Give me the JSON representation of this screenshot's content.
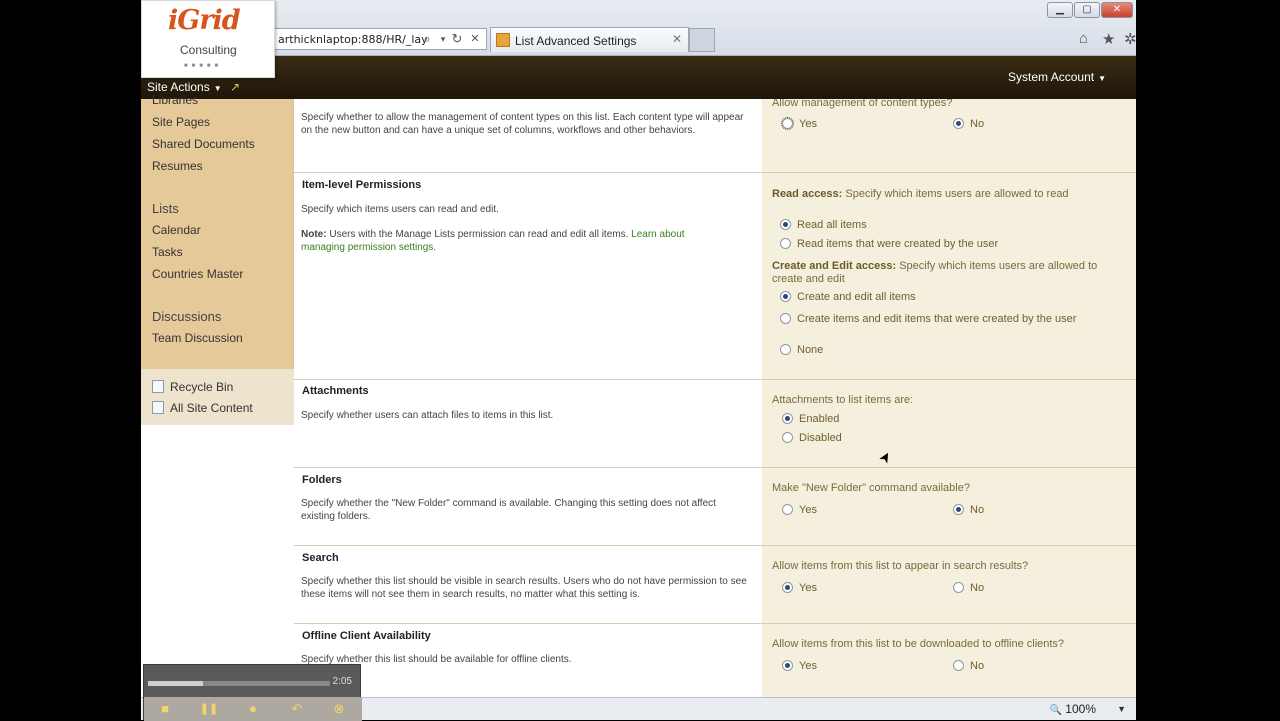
{
  "browser": {
    "address": "arthicknlaptop:888/HR/_lay",
    "tab_title": "List Advanced Settings",
    "search_glyph": "⌕",
    "dropdown_glyph": "▾",
    "refresh_glyph": "↻",
    "stop_glyph": "✕",
    "tab_close_glyph": "✕",
    "min_glyph": "▁",
    "max_glyph": "▢",
    "close_glyph": "✕",
    "home_glyph": "⌂",
    "fav_glyph": "★",
    "tools_glyph": "✲"
  },
  "logo": {
    "brand": "iGrid",
    "tagline": "Consulting",
    "dots": "■■■■■"
  },
  "ribbon": {
    "site_actions": "Site Actions",
    "site_actions_arrow": "▼",
    "nav_icon_glyph": "↗",
    "account": "System Account",
    "account_arrow": "▼"
  },
  "quicklaunch": {
    "libraries_cut": "Libraries",
    "items_libraries": [
      "Site Pages",
      "Shared Documents",
      "Resumes"
    ],
    "lists_heading": "Lists",
    "items_lists": [
      "Calendar",
      "Tasks",
      "Countries Master"
    ],
    "discussions_heading": "Discussions",
    "items_discussions": [
      "Team Discussion"
    ],
    "recycle_bin": "Recycle Bin",
    "all_site_content": "All Site Content"
  },
  "sections": {
    "content_types": {
      "desc": "Specify whether to allow the management of content types on this list. Each content type will appear on the new button and can have a unique set of columns, workflows and other behaviors.",
      "question": "Allow management of content types?",
      "yes": "Yes",
      "no": "No",
      "selected": "no"
    },
    "permissions": {
      "title": "Item-level Permissions",
      "desc": "Specify which items users can read and edit.",
      "note_label": "Note:",
      "note_text": "Users with the Manage Lists permission can read and edit all items.",
      "note_link": "Learn about managing permission settings.",
      "read_label": "Read access:",
      "read_text": "Specify which items users are allowed to read",
      "read_all": "Read all items",
      "read_own": "Read items that were created by the user",
      "edit_label": "Create and Edit access:",
      "edit_text": "Specify which items users are allowed to create and edit",
      "edit_all": "Create and edit all items",
      "edit_own": "Create items and edit items that were created by the user",
      "edit_none": "None"
    },
    "attachments": {
      "title": "Attachments",
      "desc": "Specify whether users can attach files to items in this list.",
      "question": "Attachments to list items are:",
      "enabled": "Enabled",
      "disabled": "Disabled"
    },
    "folders": {
      "title": "Folders",
      "desc": "Specify whether the \"New Folder\" command is available. Changing this setting does not affect existing folders.",
      "question": "Make \"New Folder\" command available?",
      "yes": "Yes",
      "no": "No"
    },
    "search": {
      "title": "Search",
      "desc": "Specify whether this list should be visible in search results. Users who do not have permission to see these items will not see them in search results, no matter what this setting is.",
      "question": "Allow items from this list to appear in search results?",
      "yes": "Yes",
      "no": "No"
    },
    "offline": {
      "title": "Offline Client Availability",
      "desc": "Specify whether this list should be available for offline clients.",
      "question": "Allow items from this list to be downloaded to offline clients?",
      "yes": "Yes",
      "no": "No"
    }
  },
  "statusbar": {
    "zoom_glyph": "🔍",
    "zoom": "100%",
    "zoom_arrow": "▼"
  },
  "player": {
    "time": "2:05",
    "progress": 0.3,
    "stop_glyph": "■",
    "pause_glyph": "❚❚",
    "mic_glyph": "●",
    "undo_glyph": "↶",
    "close_glyph": "⊗"
  },
  "cursor_glyph": "➤"
}
